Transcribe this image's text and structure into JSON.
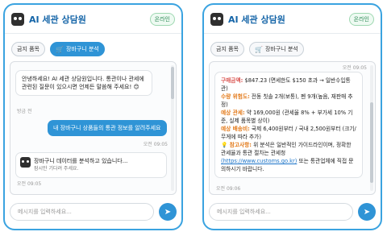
{
  "left": {
    "header": {
      "title": "AI 세관 상담원",
      "status": "온라인"
    },
    "chips": [
      {
        "label": "금지 품목"
      },
      {
        "label": "장바구니 분석"
      }
    ],
    "messages": [
      {
        "text": "안녕하세요! AI 세관 상담원입니다. 통관이나 관세에 관련된 질문이 있으시면 언제든 말씀해 주세요! 😊",
        "time": "방금 전"
      },
      {
        "text": "내 장바구니 상품들의 통관 정보를 알려주세요",
        "time": "오전 09:05"
      },
      {
        "text": "장바구니 데이터를 분석하고 있습니다...",
        "sub": "잠시만 기다려 주세요.",
        "time": "오전 09:05"
      }
    ],
    "input_placeholder": "메시지를 입력하세요..."
  },
  "right": {
    "header": {
      "title": "AI 세관 상담원",
      "status": "온라인"
    },
    "chips": [
      {
        "label": "금지 품목"
      },
      {
        "label": "장바구니 분석"
      }
    ],
    "top_time": "오전 09:05",
    "answer": {
      "l1_key": "구매금액:",
      "l1_val": "$847.23 (면세한도 $150 초과 → 일반수입통관)",
      "l2_key": "수량 위험도:",
      "l2_val": "전동 칫솔 2개(보통), 펜 9개(높음, 재판매 추정)",
      "l3_key": "예상 관세:",
      "l3_val": "약 169,000원 (관세율 8% + 부가세 10% 기준, 실제 품목별 상이)",
      "l4_key": "예상 배송비:",
      "l4_val": "국제 6,400원부터 / 국내 2,500원부터 (크기/무게에 따라 추가)",
      "l5_key": "💡 참고사항:",
      "l5_val": "위 분석은 일반적인 가이드라인이며, 정확한 관세율과 통관 절차는 관세청",
      "l5_link": "(https://www.customs.go.kr)",
      "l5_tail": "또는 통관업체에 직접 문의하시기 바랍니다."
    },
    "answer_time": "오전 09:06",
    "input_placeholder": "메시지를 입력하세요..."
  }
}
